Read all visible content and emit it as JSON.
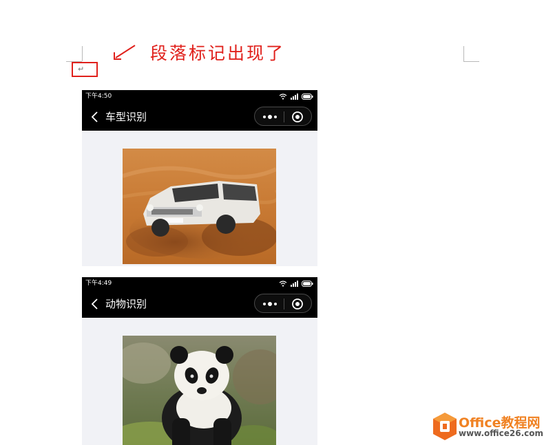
{
  "annotation": {
    "text": "段落标记出现了",
    "color": "#e0201b"
  },
  "paragraph_mark": "↵",
  "screens": [
    {
      "time": "下午4:50",
      "title": "车型识别",
      "photo": "desert-suv-photo"
    },
    {
      "time": "下午4:49",
      "title": "动物识别",
      "photo": "giant-panda-photo"
    }
  ],
  "watermark": {
    "line1": "Office教程网",
    "line2": "www.office26.com",
    "accent": "#f08223"
  }
}
